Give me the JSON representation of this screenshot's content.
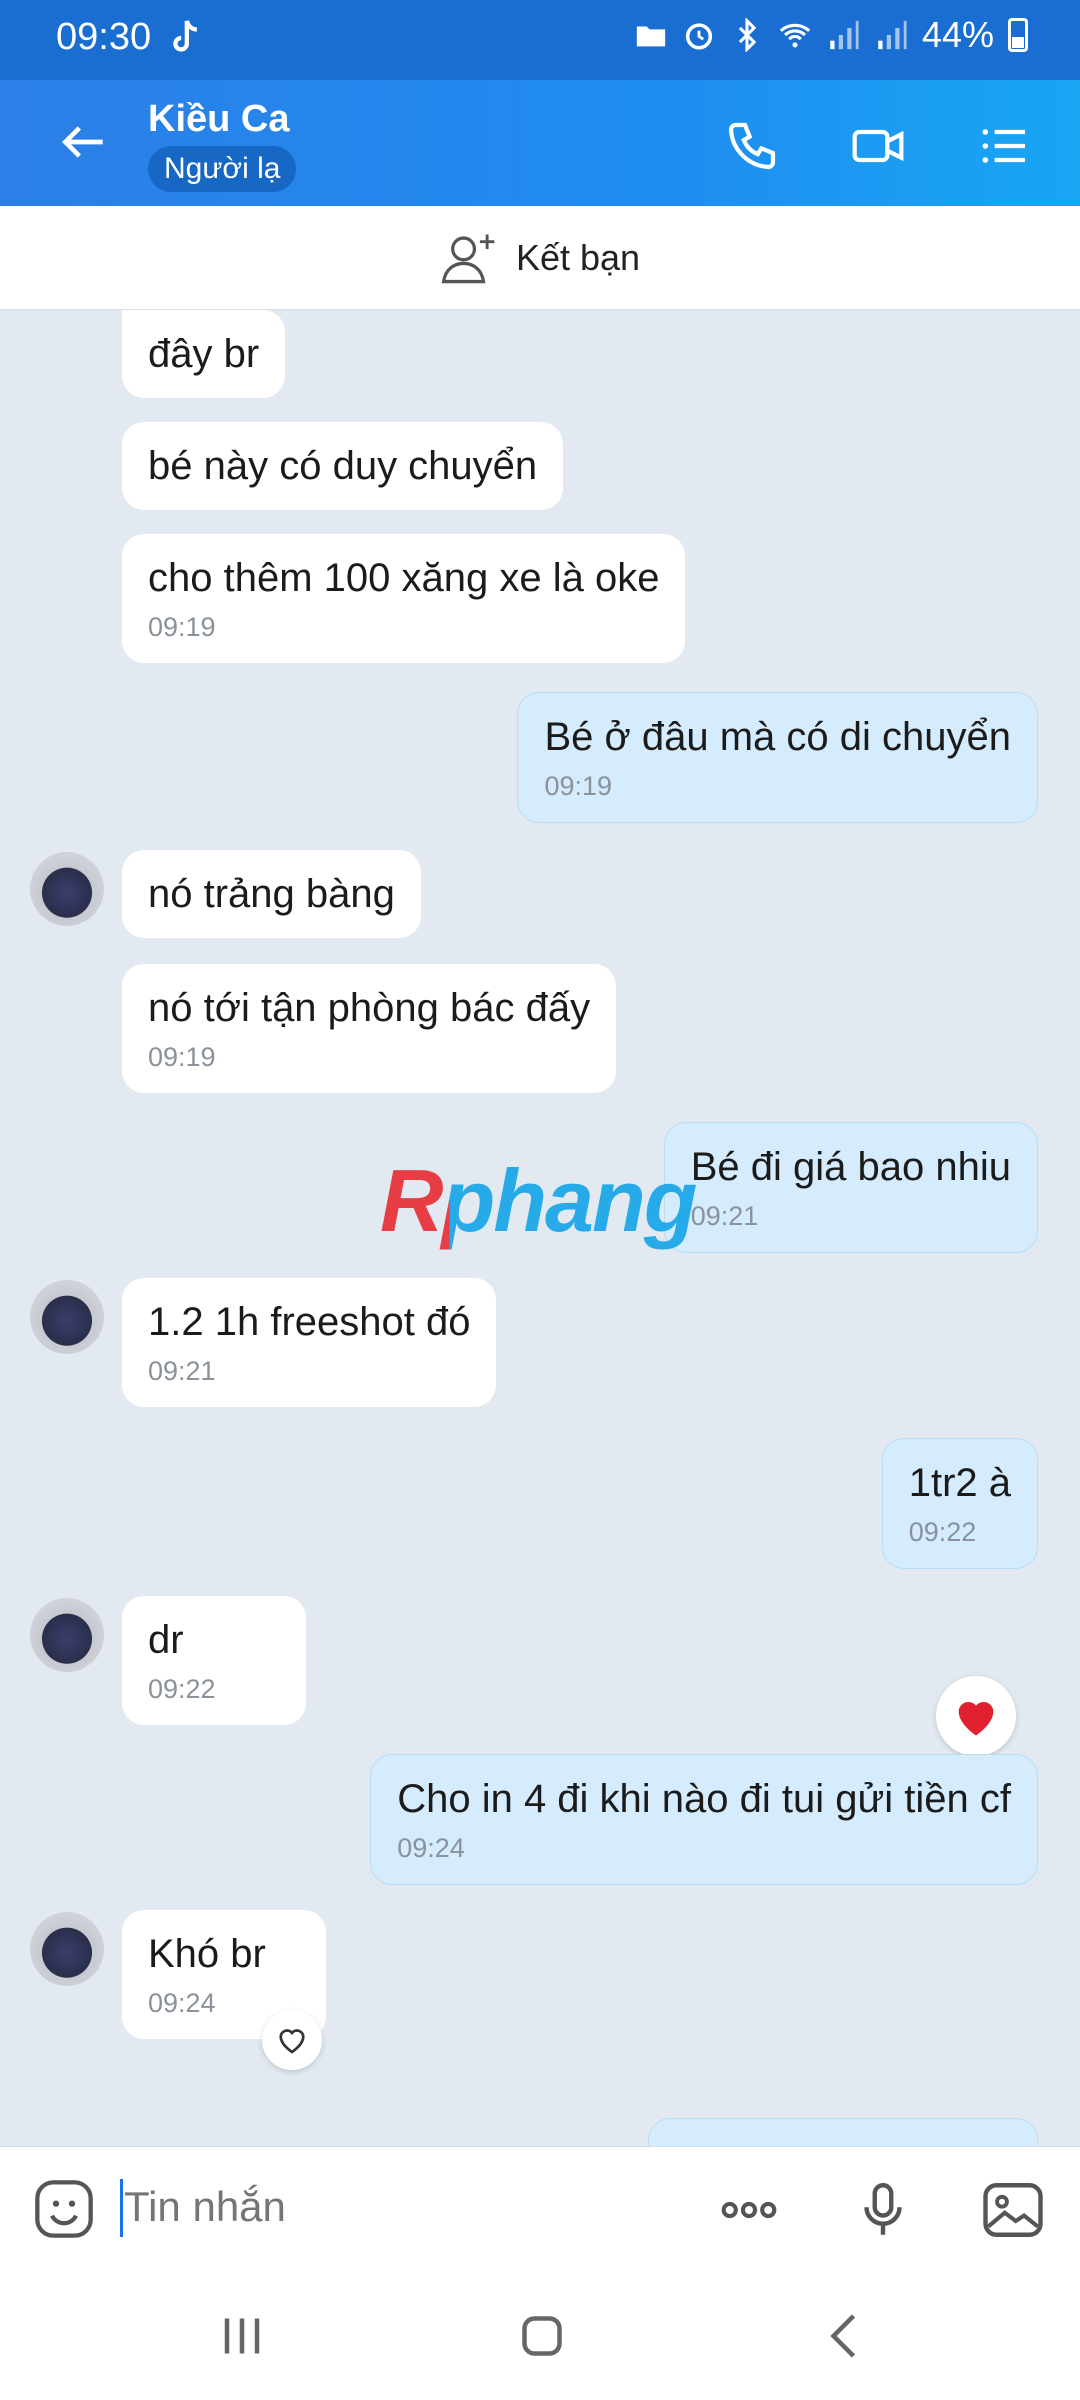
{
  "status_bar": {
    "time": "09:30",
    "battery": "44%",
    "icons": [
      "tiktok-icon",
      "folder-icon",
      "alarm-icon",
      "bluetooth-icon",
      "wifi-icon",
      "signal-icon",
      "signal-icon",
      "battery-icon"
    ]
  },
  "header": {
    "name": "Kiều Ca",
    "badge": "Người lạ",
    "back_icon": "back-arrow-icon",
    "actions": [
      "phone-icon",
      "video-call-icon",
      "menu-list-icon"
    ]
  },
  "add_friend": {
    "label": "Kết bạn",
    "icon": "add-friend-icon"
  },
  "messages": [
    {
      "dir": "in",
      "text": "đây br",
      "time": ""
    },
    {
      "dir": "in",
      "text": "bé này có duy chuyển",
      "time": ""
    },
    {
      "dir": "in",
      "text": "cho thêm 100 xăng xe là oke",
      "time": "09:19"
    },
    {
      "dir": "out",
      "text": "Bé ở đâu mà có di chuyển",
      "time": "09:19"
    },
    {
      "dir": "in",
      "text": "nó trảng bàng",
      "time": ""
    },
    {
      "dir": "in",
      "text": "nó tới tận phòng bác đấy",
      "time": "09:19"
    },
    {
      "dir": "out",
      "text": "Bé đi giá bao nhiu",
      "time": "09:21"
    },
    {
      "dir": "in",
      "text": "1.2 1h freeshot đó",
      "time": "09:21"
    },
    {
      "dir": "out",
      "text": "1tr2 à",
      "time": "09:22"
    },
    {
      "dir": "in",
      "text": "dr",
      "time": "09:22"
    },
    {
      "dir": "out",
      "text": "Cho in 4 đi khi nào đi tui gửi tiền cf",
      "time": "09:24"
    },
    {
      "dir": "in",
      "text": "Khó br",
      "time": "09:24"
    }
  ],
  "watermark": "Rphang",
  "input_bar": {
    "placeholder": "Tin nhắn",
    "icons": [
      "emoji-icon",
      "more-icon",
      "microphone-icon",
      "image-icon"
    ]
  },
  "nav_bar": {
    "icons": [
      "recents-icon",
      "home-icon",
      "back-icon"
    ]
  },
  "colors": {
    "header_start": "#2b7fe6",
    "header_end": "#18a6f3",
    "chat_bg": "#e2e9f1",
    "incoming_bubble": "#ffffff",
    "outgoing_bubble": "#d4ecfd",
    "heart": "#e0202f"
  }
}
